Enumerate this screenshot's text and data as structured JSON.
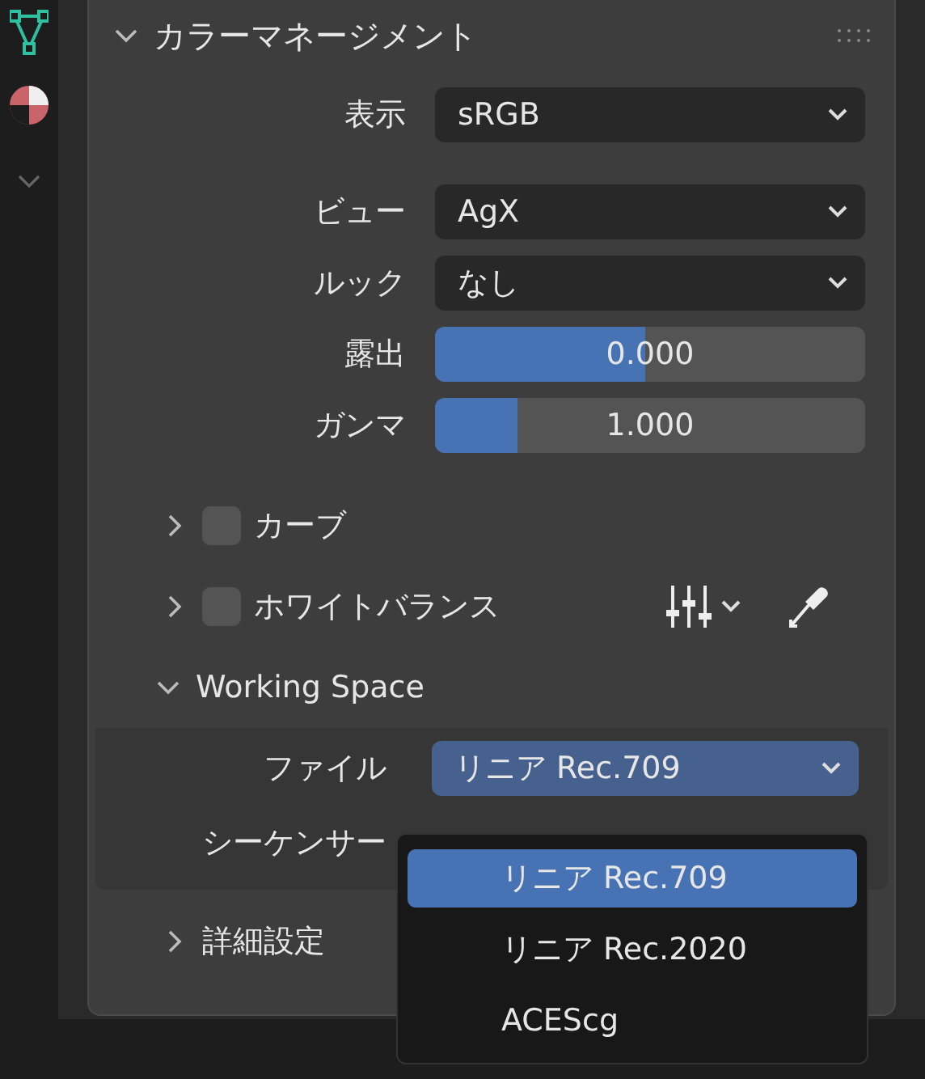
{
  "panel": {
    "title": "カラーマネージメント",
    "expanded": true
  },
  "fields": [
    {
      "kind": "dropdown",
      "label": "表示",
      "value": "sRGB"
    },
    {
      "kind": "dropdown",
      "label": "ビュー",
      "value": "AgX"
    },
    {
      "kind": "dropdown",
      "label": "ルック",
      "value": "なし"
    },
    {
      "kind": "slider",
      "label": "露出",
      "value": "0.000",
      "level": 0.49
    },
    {
      "kind": "slider",
      "label": "ガンマ",
      "value": "1.000",
      "level": 0.19
    }
  ],
  "subpanels": [
    {
      "kind": "toggle",
      "label": "カーブ",
      "expanded": false,
      "checked": false
    },
    {
      "kind": "toggle",
      "label": "ホワイトバランス",
      "expanded": false,
      "checked": false,
      "tools": true
    }
  ],
  "working_space": {
    "label": "Working Space",
    "expanded": true,
    "fields": [
      {
        "label": "ファイル",
        "value": "リニア Rec.709",
        "open": true
      },
      {
        "label": "シーケンサー"
      }
    ]
  },
  "advanced": {
    "label": "詳細設定",
    "expanded": false
  },
  "menu": {
    "items": [
      {
        "label": "リニア Rec.709",
        "selected": true
      },
      {
        "label": "リニア Rec.2020",
        "selected": false
      },
      {
        "label": "ACEScg",
        "selected": false
      }
    ]
  }
}
